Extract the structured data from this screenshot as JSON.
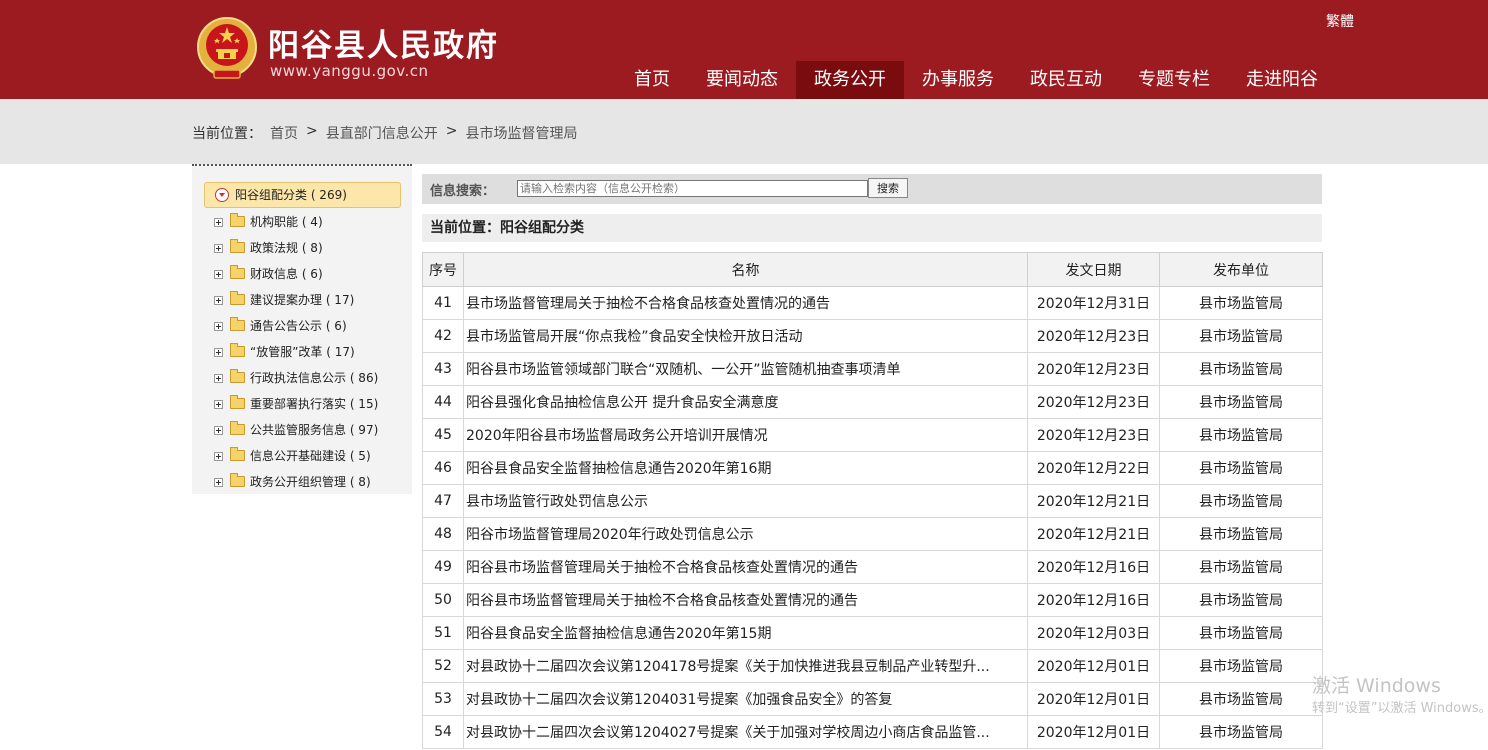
{
  "header": {
    "site_title": "阳谷县人民政府",
    "site_url": "www.yanggu.gov.cn",
    "lang_switch": "繁體",
    "nav": [
      {
        "label": "首页",
        "active": false
      },
      {
        "label": "要闻动态",
        "active": false
      },
      {
        "label": "政务公开",
        "active": true
      },
      {
        "label": "办事服务",
        "active": false
      },
      {
        "label": "政民互动",
        "active": false
      },
      {
        "label": "专题专栏",
        "active": false
      },
      {
        "label": "走进阳谷",
        "active": false
      }
    ]
  },
  "breadcrumb": {
    "prefix": "当前位置：",
    "items": [
      "首页",
      "县直部门信息公开",
      "县市场监督管理局"
    ],
    "separator": ">"
  },
  "tree": {
    "root": "阳谷组配分类 ( 269)",
    "items": [
      "机构职能 ( 4)",
      "政策法规 ( 8)",
      "财政信息 ( 6)",
      "建议提案办理 ( 17)",
      "通告公告公示 ( 6)",
      "“放管服”改革 ( 17)",
      "行政执法信息公示 ( 86)",
      "重要部署执行落实 ( 15)",
      "公共监管服务信息 ( 97)",
      "信息公开基础建设 ( 5)",
      "政务公开组织管理 ( 8)"
    ]
  },
  "search": {
    "label": "信息搜索：",
    "placeholder": "请输入检索内容（信息公开检索）",
    "button": "搜索"
  },
  "current_position": "当前位置：阳谷组配分类",
  "table": {
    "headers": [
      "序号",
      "名称",
      "发文日期",
      "发布单位"
    ],
    "rows": [
      [
        "41",
        "县市场监督管理局关于抽检不合格食品核查处置情况的通告",
        "2020年12月31日",
        "县市场监管局"
      ],
      [
        "42",
        "县市场监管局开展“你点我检”食品安全快检开放日活动",
        "2020年12月23日",
        "县市场监管局"
      ],
      [
        "43",
        "阳谷县市场监管领域部门联合“双随机、一公开”监管随机抽查事项清单",
        "2020年12月23日",
        "县市场监管局"
      ],
      [
        "44",
        "阳谷县强化食品抽检信息公开 提升食品安全满意度",
        "2020年12月23日",
        "县市场监管局"
      ],
      [
        "45",
        "2020年阳谷县市场监督局政务公开培训开展情况",
        "2020年12月23日",
        "县市场监管局"
      ],
      [
        "46",
        "阳谷县食品安全监督抽检信息通告2020年第16期",
        "2020年12月22日",
        "县市场监管局"
      ],
      [
        "47",
        "县市场监管行政处罚信息公示",
        "2020年12月21日",
        "县市场监管局"
      ],
      [
        "48",
        "阳谷市场监督管理局2020年行政处罚信息公示",
        "2020年12月21日",
        "县市场监管局"
      ],
      [
        "49",
        "阳谷县市场监督管理局关于抽检不合格食品核查处置情况的通告",
        "2020年12月16日",
        "县市场监管局"
      ],
      [
        "50",
        "阳谷县市场监督管理局关于抽检不合格食品核查处置情况的通告",
        "2020年12月16日",
        "县市场监管局"
      ],
      [
        "51",
        "阳谷县食品安全监督抽检信息通告2020年第15期",
        "2020年12月03日",
        "县市场监管局"
      ],
      [
        "52",
        "对县政协十二届四次会议第1204178号提案《关于加快推进我县豆制品产业转型升...",
        "2020年12月01日",
        "县市场监管局"
      ],
      [
        "53",
        "对县政协十二届四次会议第1204031号提案《加强食品安全》的答复",
        "2020年12月01日",
        "县市场监管局"
      ],
      [
        "54",
        "对县政协十二届四次会议第1204027号提案《关于加强对学校周边小商店食品监管...",
        "2020年12月01日",
        "县市场监管局"
      ]
    ]
  },
  "watermark": {
    "line1": "激活 Windows",
    "line2": "转到“设置”以激活 Windows。"
  },
  "colors": {
    "header_bg": "#9b1b20",
    "nav_active_bg": "#7a0c10",
    "tree_root_bg": "#fce6a9"
  }
}
